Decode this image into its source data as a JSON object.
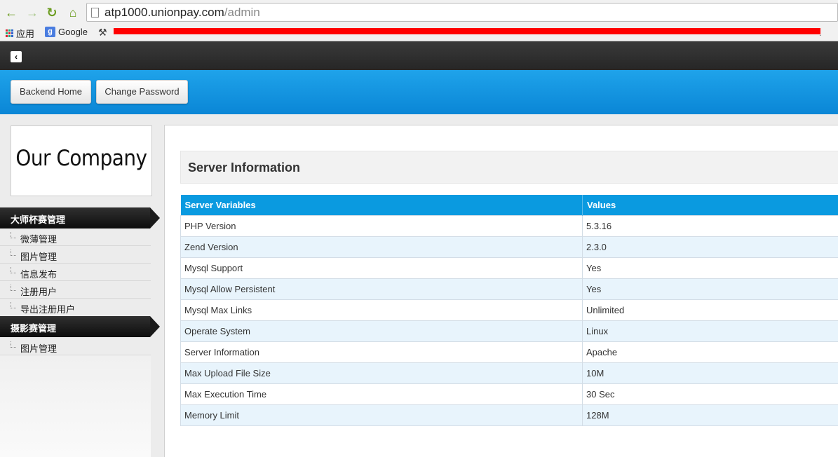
{
  "browser": {
    "url_host": "atp1000.unionpay.com",
    "url_path": "/admin",
    "bookmarks": {
      "apps_label": "应用",
      "google_label": "Google",
      "google_icon": "g",
      "overflow": "."
    }
  },
  "header": {
    "buttons": {
      "home": "Backend Home",
      "password": "Change Password"
    }
  },
  "sidebar": {
    "logo": "Our Company",
    "sections": [
      {
        "title": "大师杯赛管理",
        "items": [
          "微薄管理",
          "图片管理",
          "信息发布",
          "注册用户",
          "导出注册用户"
        ]
      },
      {
        "title": "摄影赛管理",
        "items": [
          "图片管理"
        ]
      }
    ]
  },
  "main": {
    "title": "Server Information",
    "table": {
      "headers": [
        "Server Variables",
        "Values"
      ],
      "rows": [
        [
          "PHP Version",
          "5.3.16"
        ],
        [
          "Zend Version",
          "2.3.0"
        ],
        [
          "Mysql Support",
          "Yes"
        ],
        [
          "Mysql Allow Persistent",
          "Yes"
        ],
        [
          "Mysql Max Links",
          "Unlimited"
        ],
        [
          "Operate System",
          "Linux"
        ],
        [
          "Server Information",
          "Apache"
        ],
        [
          "Max Upload File Size",
          "10M"
        ],
        [
          "Max Execution Time",
          "30 Sec"
        ],
        [
          "Memory Limit",
          "128M"
        ]
      ]
    }
  },
  "colors": {
    "topbar": "#262626",
    "header_blue": "#1fa3ea",
    "table_header": "#0a9ae0",
    "row_alt": "#e8f4fc",
    "redaction": "#ff0000"
  }
}
